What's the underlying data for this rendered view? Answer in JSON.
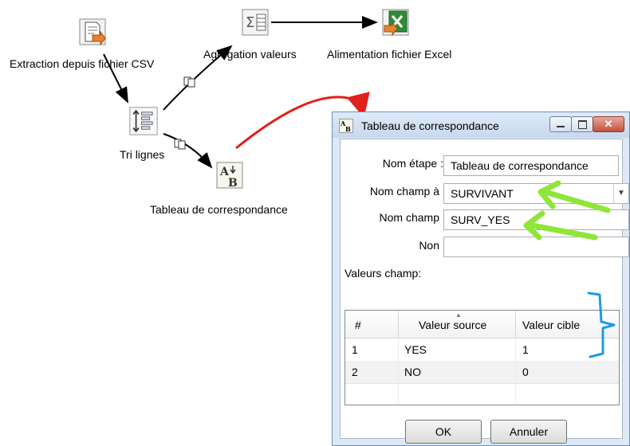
{
  "canvas": {
    "steps": [
      {
        "name": "csv-input-step",
        "label": "Extraction depuis fichier CSV",
        "icon": "csv-file-input-icon"
      },
      {
        "name": "group-by-step",
        "label": "Agrégation valeurs",
        "icon": "sum-aggregate-icon"
      },
      {
        "name": "excel-output-step",
        "label": "Alimentation fichier Excel",
        "icon": "excel-output-icon"
      },
      {
        "name": "sort-rows-step",
        "label": "Tri lignes",
        "icon": "sort-rows-icon"
      },
      {
        "name": "value-mapper-step",
        "label": "Tableau de correspondance",
        "icon": "value-mapper-icon"
      }
    ],
    "hop_icons": [
      "copy-rows-icon",
      "copy-rows-icon"
    ]
  },
  "annotations": {
    "arrow_color": "#e0201b",
    "green_arrows_color": "#8ee63a",
    "bracket_color": "#1e9be0"
  },
  "dialog": {
    "title": "Tableau de correspondance",
    "title_icon": "value-mapper-icon",
    "window_buttons": [
      "minimize-icon",
      "maximize-icon",
      "close-icon"
    ],
    "fields": {
      "step_name_label": "Nom étape :",
      "step_name_value": "Tableau de correspondance",
      "source_field_label": "Nom champ à",
      "source_field_value": "SURVIVANT",
      "target_field_label": "Nom champ",
      "target_field_value": "SURV_YES",
      "default_label": "Non",
      "default_value": ""
    },
    "values_label": "Valeurs champ:",
    "table": {
      "headers": [
        "#",
        "Valeur source",
        "Valeur cible"
      ],
      "rows": [
        {
          "num": "1",
          "source": "YES",
          "target": "1"
        },
        {
          "num": "2",
          "source": "NO",
          "target": "0"
        }
      ]
    },
    "ok_label": "OK",
    "cancel_label": "Annuler"
  }
}
